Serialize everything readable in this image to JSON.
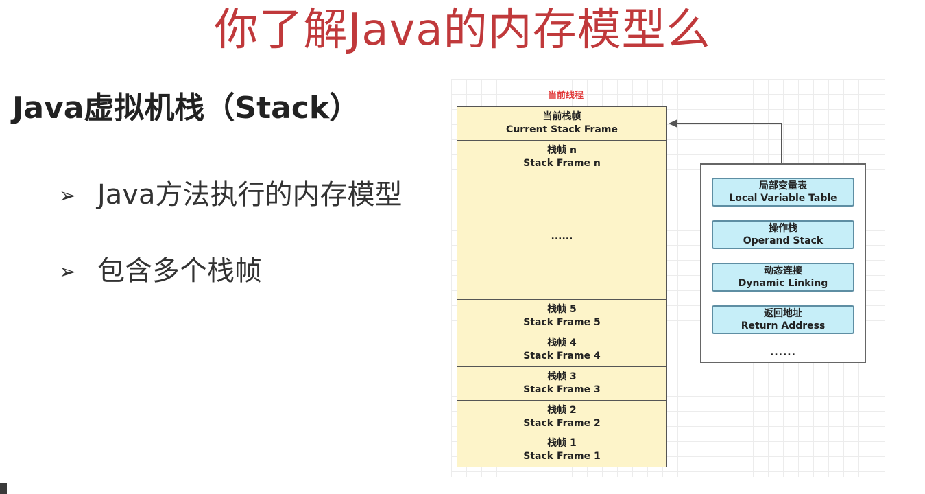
{
  "title": "你了解Java的内存模型么",
  "subtitle": "Java虚拟机栈（Stack）",
  "bullets": [
    {
      "marker": "➢",
      "text": "Java方法执行的内存模型"
    },
    {
      "marker": "➢",
      "text": "包含多个栈帧"
    }
  ],
  "diagram": {
    "thread_label": "当前线程",
    "frames": [
      {
        "cn": "当前栈帧",
        "en": "Current Stack Frame"
      },
      {
        "cn": "栈帧 n",
        "en": "Stack Frame n"
      },
      {
        "cn": "......",
        "en": ""
      },
      {
        "cn": "栈帧 5",
        "en": "Stack Frame 5"
      },
      {
        "cn": "栈帧 4",
        "en": "Stack Frame 4"
      },
      {
        "cn": "栈帧 3",
        "en": "Stack Frame 3"
      },
      {
        "cn": "栈帧 2",
        "en": "Stack Frame 2"
      },
      {
        "cn": "栈帧 1",
        "en": "Stack Frame 1"
      }
    ],
    "frame_details": [
      {
        "cn": "局部变量表",
        "en": "Local Variable Table"
      },
      {
        "cn": "操作栈",
        "en": "Operand Stack"
      },
      {
        "cn": "动态连接",
        "en": "Dynamic Linking"
      },
      {
        "cn": "返回地址",
        "en": "Return Address"
      }
    ],
    "details_ellipsis": "......",
    "colors": {
      "title": "#c0393b",
      "thread_label": "#e23a3a",
      "frame_fill": "#fdf4c9",
      "detail_fill": "#c6eef8",
      "detail_border": "#5e8ea3"
    }
  }
}
